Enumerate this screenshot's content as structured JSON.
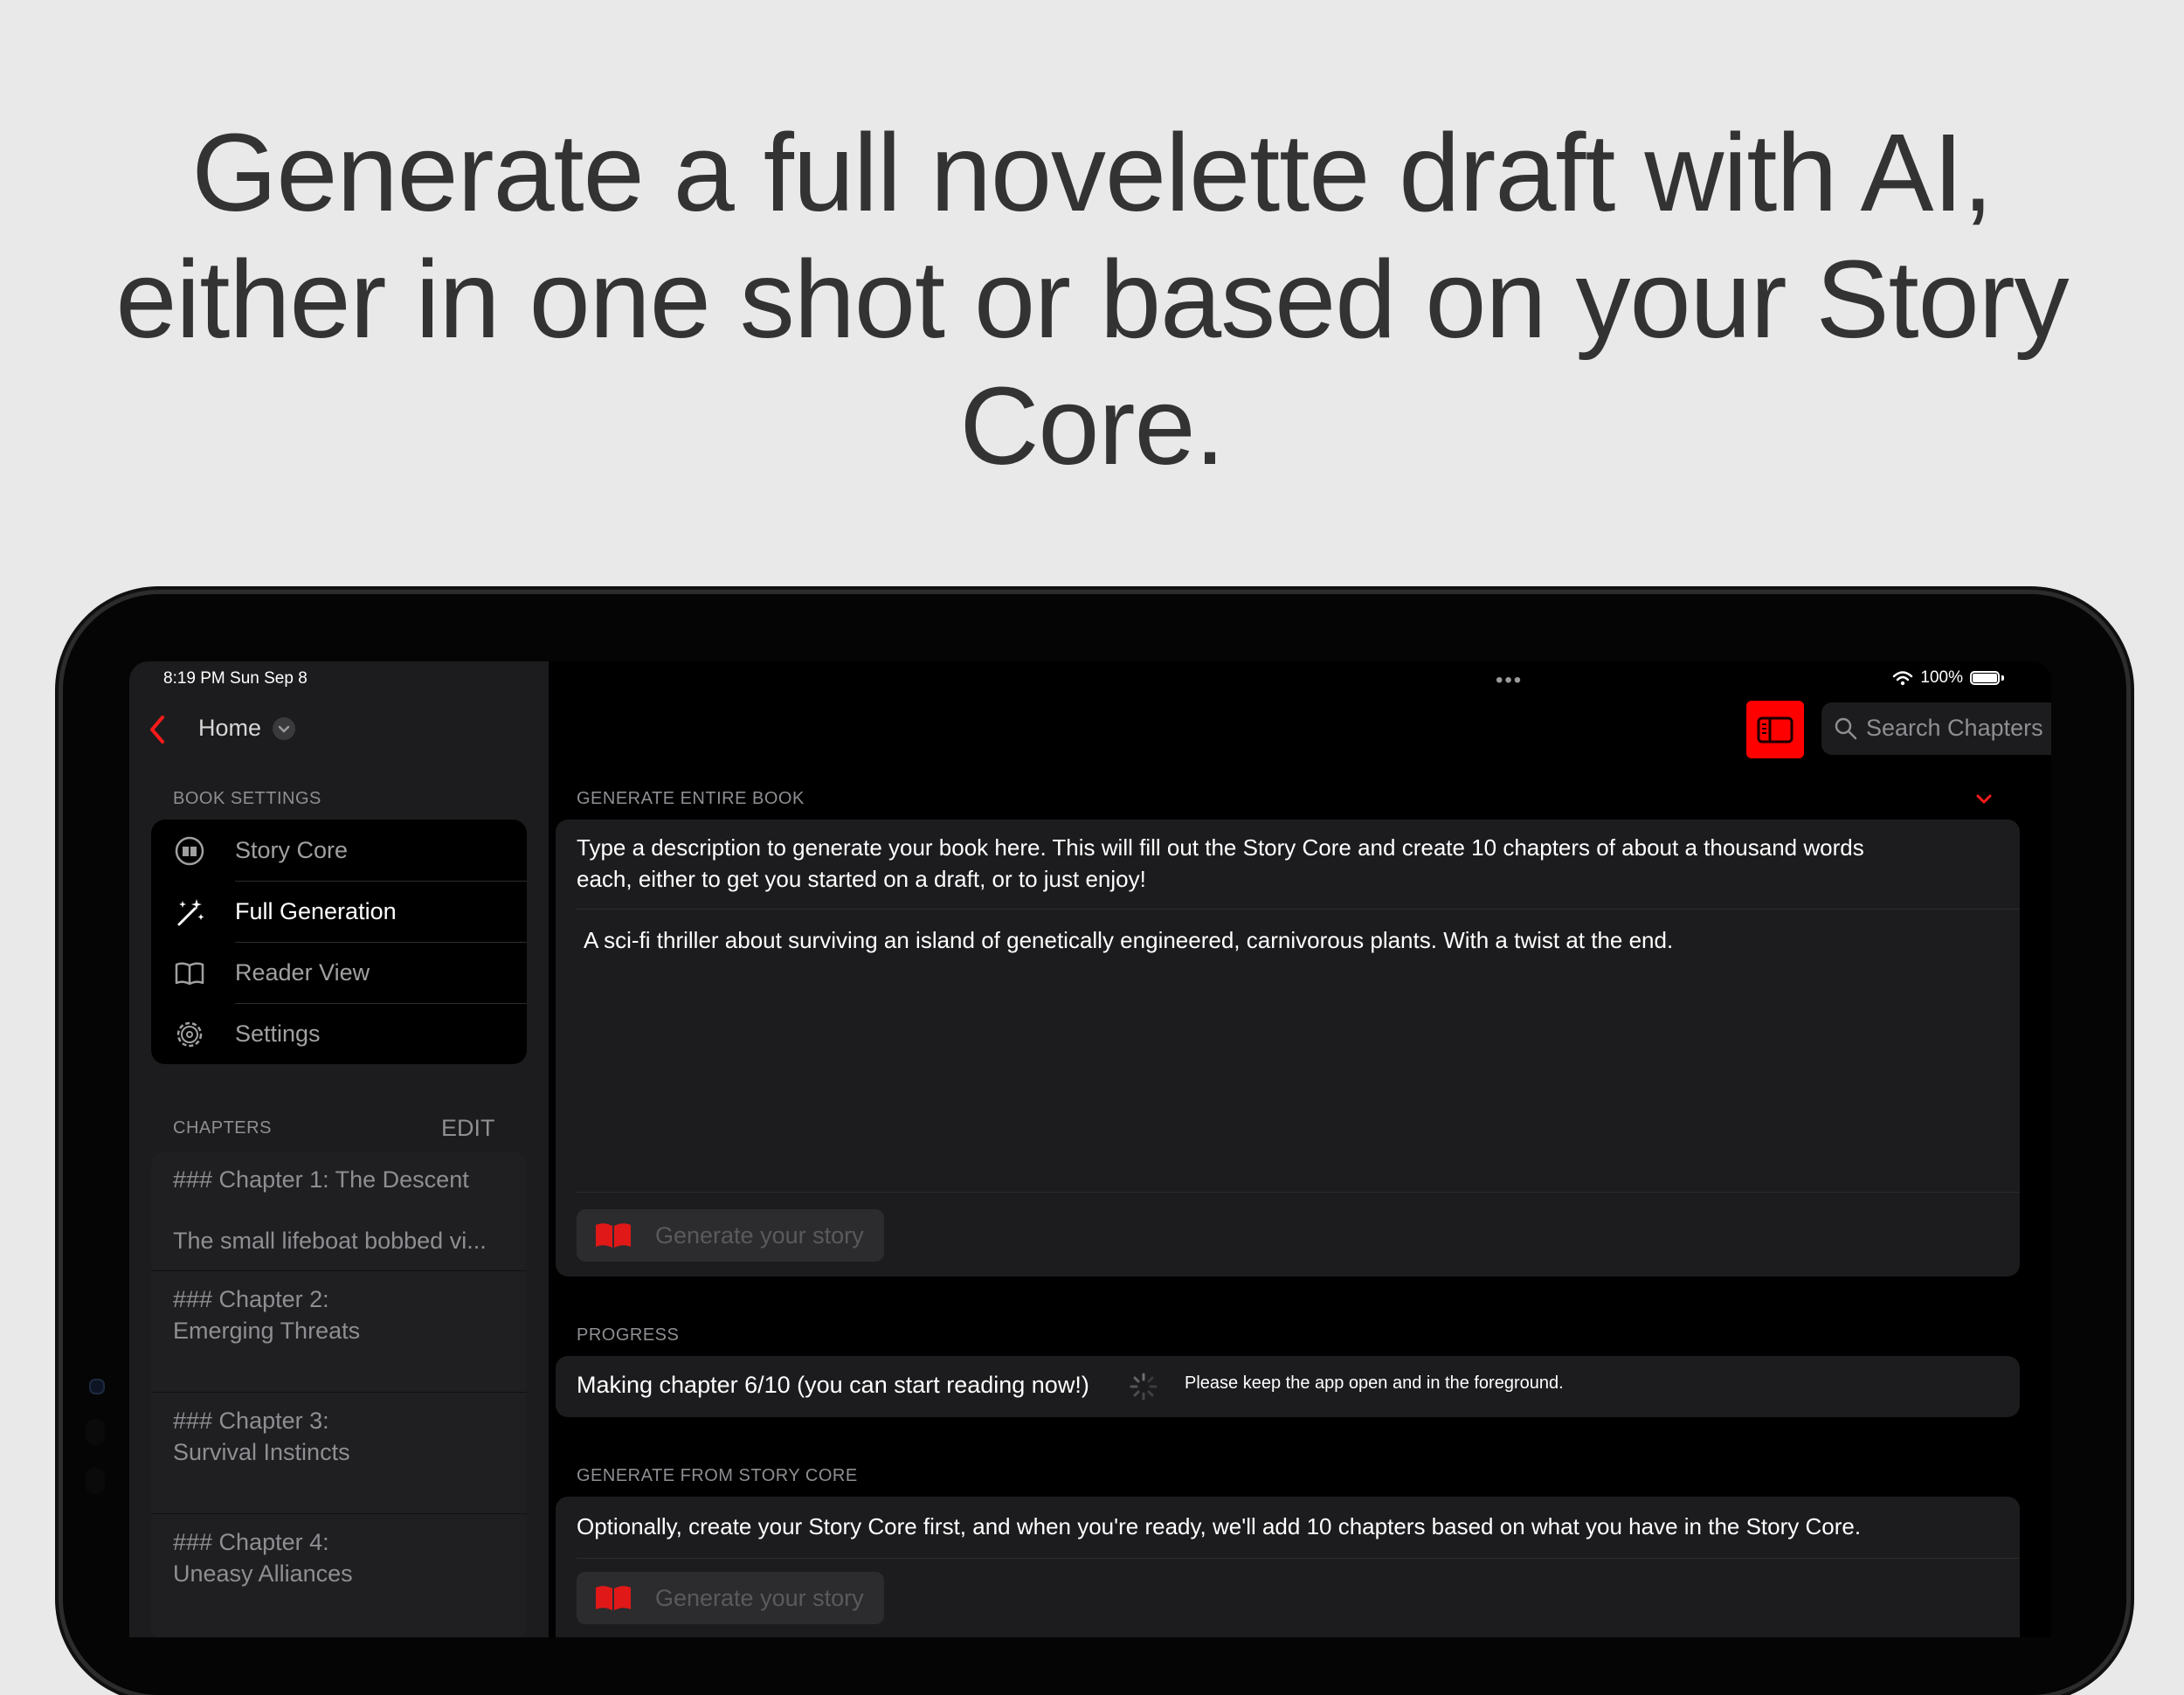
{
  "headline": {
    "line1": "Generate a full novelette draft with AI,",
    "line2": "either in one shot or based on your Story",
    "line3": "Core."
  },
  "status_bar": {
    "time": "8:19 PM   Sun Sep 8",
    "battery": "100%"
  },
  "sidebar": {
    "back_label": "Home",
    "book_settings_header": "BOOK SETTINGS",
    "items": [
      {
        "label": "Story Core",
        "icon": "book-circle-icon",
        "active": false
      },
      {
        "label": "Full Generation",
        "icon": "magic-wand-icon",
        "active": true
      },
      {
        "label": "Reader View",
        "icon": "open-book-icon",
        "active": false
      },
      {
        "label": "Settings",
        "icon": "gear-icon",
        "active": false
      }
    ],
    "chapters_header": "CHAPTERS",
    "edit_label": "EDIT",
    "chapters": [
      {
        "title": "### Chapter 1: The Descent",
        "preview": "The small lifeboat bobbed vi..."
      },
      {
        "title": "### Chapter 2:",
        "subtitle": "Emerging Threats"
      },
      {
        "title": "### Chapter 3:",
        "subtitle": "Survival Instincts"
      },
      {
        "title": "### Chapter 4:",
        "subtitle": "Uneasy Alliances"
      }
    ]
  },
  "toolbar": {
    "search_placeholder": "Search Chapters",
    "toggle_icon": "sidebar-toggle-icon"
  },
  "generate_entire_book": {
    "header": "GENERATE ENTIRE BOOK",
    "description_line1": "Type a description to generate your book here. This will fill out the Story Core and create 10 chapters of about a thousand words",
    "description_line2": "each, either to get you started on a draft, or to just enjoy!",
    "input_value": "A sci-fi thriller about surviving an island of genetically engineered, carnivorous plants. With a twist at the end.",
    "button_label": "Generate your story"
  },
  "progress": {
    "header": "PROGRESS",
    "status": "Making chapter 6/10 (you can start reading now!)",
    "note": "Please keep the app open and in the foreground."
  },
  "generate_from_story_core": {
    "header": "GENERATE FROM STORY CORE",
    "description": "Optionally, create your Story Core first, and when you're ready, we'll add 10 chapters based on what you have in the Story Core.",
    "button_label": "Generate your story"
  },
  "colors": {
    "accent": "#ff0000",
    "background": "#e9e9e9",
    "panel": "#1c1c1e"
  }
}
